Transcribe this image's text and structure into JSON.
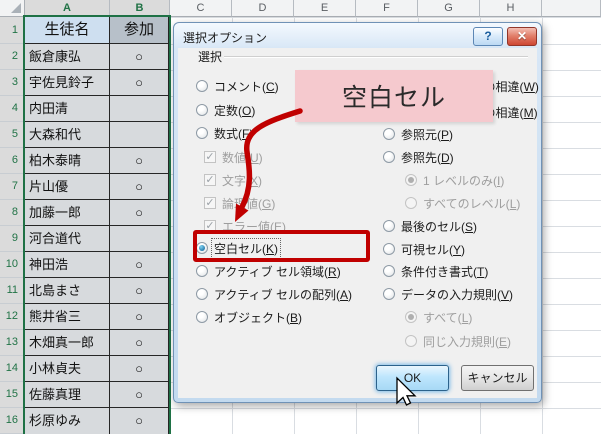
{
  "sheet": {
    "column_headers": [
      "A",
      "B",
      "C",
      "D",
      "E",
      "F",
      "G",
      "H"
    ],
    "selected_columns": [
      "A",
      "B"
    ],
    "row_numbers": [
      "1",
      "2",
      "3",
      "4",
      "5",
      "6",
      "7",
      "8",
      "9",
      "10",
      "11",
      "12",
      "13",
      "14",
      "15",
      "16"
    ],
    "table": {
      "headers": [
        "生徒名",
        "参加"
      ],
      "rows": [
        {
          "name": "飯倉康弘",
          "mark": "○"
        },
        {
          "name": "宇佐見鈴子",
          "mark": "○"
        },
        {
          "name": "内田清",
          "mark": ""
        },
        {
          "name": "大森和代",
          "mark": ""
        },
        {
          "name": "柏木泰晴",
          "mark": "○"
        },
        {
          "name": "片山優",
          "mark": "○"
        },
        {
          "name": "加藤一郎",
          "mark": "○"
        },
        {
          "name": "河合道代",
          "mark": ""
        },
        {
          "name": "神田浩",
          "mark": "○"
        },
        {
          "name": "北島まさ",
          "mark": "○"
        },
        {
          "name": "熊井省三",
          "mark": "○"
        },
        {
          "name": "木畑真一郎",
          "mark": "○"
        },
        {
          "name": "小林貞夫",
          "mark": "○"
        },
        {
          "name": "佐藤真理",
          "mark": "○"
        },
        {
          "name": "杉原ゆみ",
          "mark": "○"
        }
      ]
    },
    "colors": {
      "selection_green": "#217346"
    }
  },
  "dialog": {
    "title": "選択オプション",
    "icons": {
      "help": "?",
      "close": "✕",
      "check": "✓"
    },
    "group_label": "選択",
    "left": {
      "comments": "コメント(C)",
      "constants": "定数(O)",
      "formulas": "数式(F)",
      "numbers": "数値(U)",
      "text": "文字(X)",
      "logicals": "論理値(G)",
      "errors": "エラー値(E)",
      "blanks": "空白セル(K)",
      "current_region": "アクティブ セル領域(R)",
      "current_array": "アクティブ セルの配列(A)",
      "objects": "オブジェクト(B)"
    },
    "right": {
      "row_differences": "アクティブ行との相違(W)",
      "column_differences": "アクティブ列との相違(M)",
      "precedents": "参照元(P)",
      "dependents": "参照先(D)",
      "direct_only": "1 レベルのみ(I)",
      "all_levels": "すべてのレベル(L)",
      "last_cell": "最後のセル(S)",
      "visible_cells": "可視セル(Y)",
      "conditional_formats": "条件付き書式(T)",
      "data_validation": "データの入力規則(V)",
      "validation_all": "すべて(L)",
      "validation_same": "同じ入力規則(E)"
    },
    "selected_option": "空白セル(K)",
    "buttons": {
      "ok": "OK",
      "cancel": "キャンセル"
    }
  },
  "annotation": {
    "callout_text": "空白セル",
    "accent_color": "#c00000",
    "callout_fill": "#f5c9ce"
  }
}
